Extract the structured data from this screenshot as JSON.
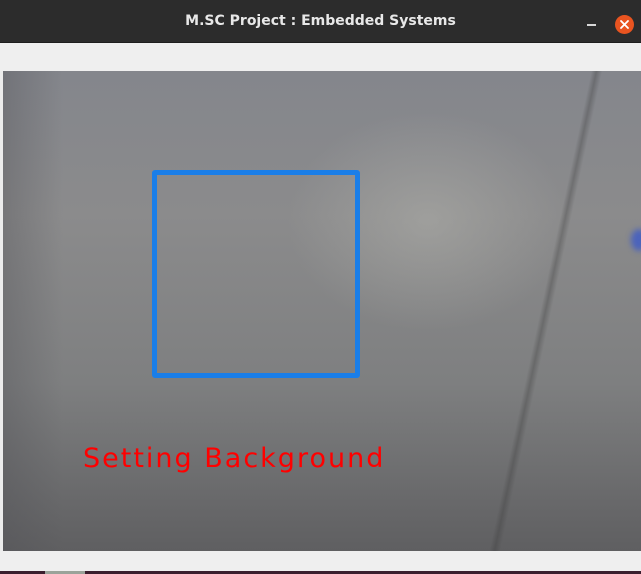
{
  "window": {
    "title": "M.SC Project : Embedded Systems"
  },
  "titlebar_buttons": {
    "minimize_icon": "minimize-icon",
    "close_icon": "close-icon",
    "close_color": "#e95420"
  },
  "video_frame": {
    "overlay_text": "Setting Background",
    "overlay_text_color": "#ff0000",
    "roi_box_color": "#1a7ee8"
  }
}
